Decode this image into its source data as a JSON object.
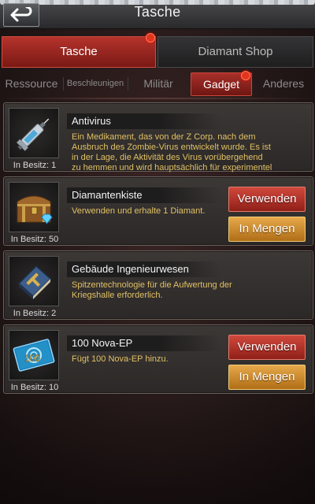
{
  "header": {
    "title": "Tasche"
  },
  "main_tabs": [
    {
      "label": "Tasche",
      "active": true,
      "has_badge": true
    },
    {
      "label": "Diamant Shop",
      "active": false
    }
  ],
  "sub_tabs": [
    {
      "label": "Ressource",
      "active": false
    },
    {
      "label": "Beschleunigen",
      "active": false
    },
    {
      "label": "Militär",
      "active": false
    },
    {
      "label": "Gadget",
      "active": true,
      "has_badge": true
    },
    {
      "label": "Anderes",
      "active": false
    }
  ],
  "items": [
    {
      "name": "Antivirus",
      "owned": "In Besitz: 1",
      "description": [
        "Ein Medikament, das von der Z Corp. nach dem",
        "Ausbruch des Zombie-Virus entwickelt wurde. Es ist",
        "in der Lage, die Aktivität des Virus vorübergehend",
        "zu hemmen und wird hauptsächlich für experimentel"
      ],
      "icon": "syringe-icon"
    },
    {
      "name": "Diamantenkiste",
      "owned": "In Besitz: 50",
      "description": [
        "Verwenden und erhalte 1 Diamant."
      ],
      "icon": "treasure-chest-icon",
      "use_label": "Verwenden",
      "bulk_label": "In Mengen"
    },
    {
      "name": "Gebäude Ingenieurwesen",
      "owned": "In Besitz: 2",
      "description": [
        "Spitzentechnologie für die Aufwertung der",
        "Kriegshalle erforderlich."
      ],
      "icon": "engineering-book-icon"
    },
    {
      "name": "100 Nova-EP",
      "owned": "In Besitz: 10",
      "description": [
        "Fügt 100 Nova-EP hinzu."
      ],
      "icon": "nova-ep-card-icon",
      "icon_text": "100",
      "use_label": "Verwenden",
      "bulk_label": "In Mengen"
    }
  ],
  "colors": {
    "accent_red": "#b5332c",
    "gold_button": "#e6a94a",
    "description_text": "#e0c064",
    "badge": "#e0351f"
  }
}
